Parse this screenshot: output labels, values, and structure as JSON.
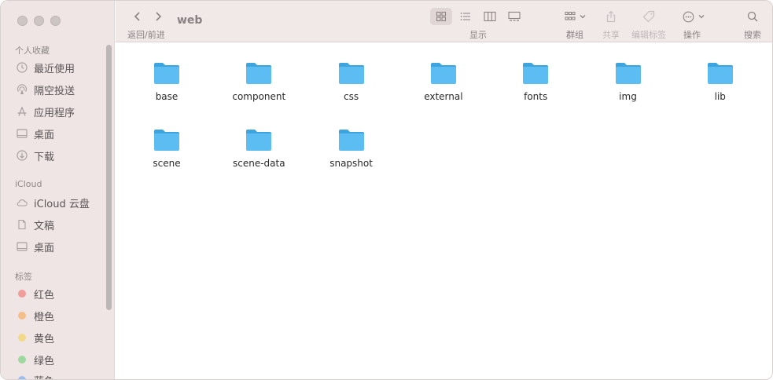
{
  "window": {
    "title": "web"
  },
  "sidebar": {
    "favorites_title": "个人收藏",
    "favorites": [
      {
        "label": "最近使用",
        "icon": "clock-icon"
      },
      {
        "label": "隔空投送",
        "icon": "airdrop-icon"
      },
      {
        "label": "应用程序",
        "icon": "applications-icon"
      },
      {
        "label": "桌面",
        "icon": "desktop-icon"
      },
      {
        "label": "下载",
        "icon": "download-icon"
      }
    ],
    "icloud_title": "iCloud",
    "icloud": [
      {
        "label": "iCloud 云盘",
        "icon": "cloud-icon"
      },
      {
        "label": "文稿",
        "icon": "document-icon"
      },
      {
        "label": "桌面",
        "icon": "desktop-icon"
      }
    ],
    "tags_title": "标签",
    "tags": [
      {
        "label": "红色",
        "color": "#f29b9b"
      },
      {
        "label": "橙色",
        "color": "#f3c08c"
      },
      {
        "label": "黄色",
        "color": "#f2d98a"
      },
      {
        "label": "绿色",
        "color": "#9fd89f"
      },
      {
        "label": "蓝色",
        "color": "#9bbdf0"
      }
    ]
  },
  "toolbar": {
    "nav_label": "返回/前进",
    "view_label": "显示",
    "group_label": "群组",
    "share_label": "共享",
    "tags_label": "编辑标签",
    "action_label": "操作",
    "search_label": "搜索"
  },
  "folders": [
    {
      "name": "base"
    },
    {
      "name": "component"
    },
    {
      "name": "css"
    },
    {
      "name": "external"
    },
    {
      "name": "fonts"
    },
    {
      "name": "img"
    },
    {
      "name": "lib"
    },
    {
      "name": "scene"
    },
    {
      "name": "scene-data"
    },
    {
      "name": "snapshot"
    }
  ],
  "colors": {
    "folder": "#5cbdf2",
    "folder_tab": "#3ea4dd",
    "accent": "#8a8282"
  }
}
